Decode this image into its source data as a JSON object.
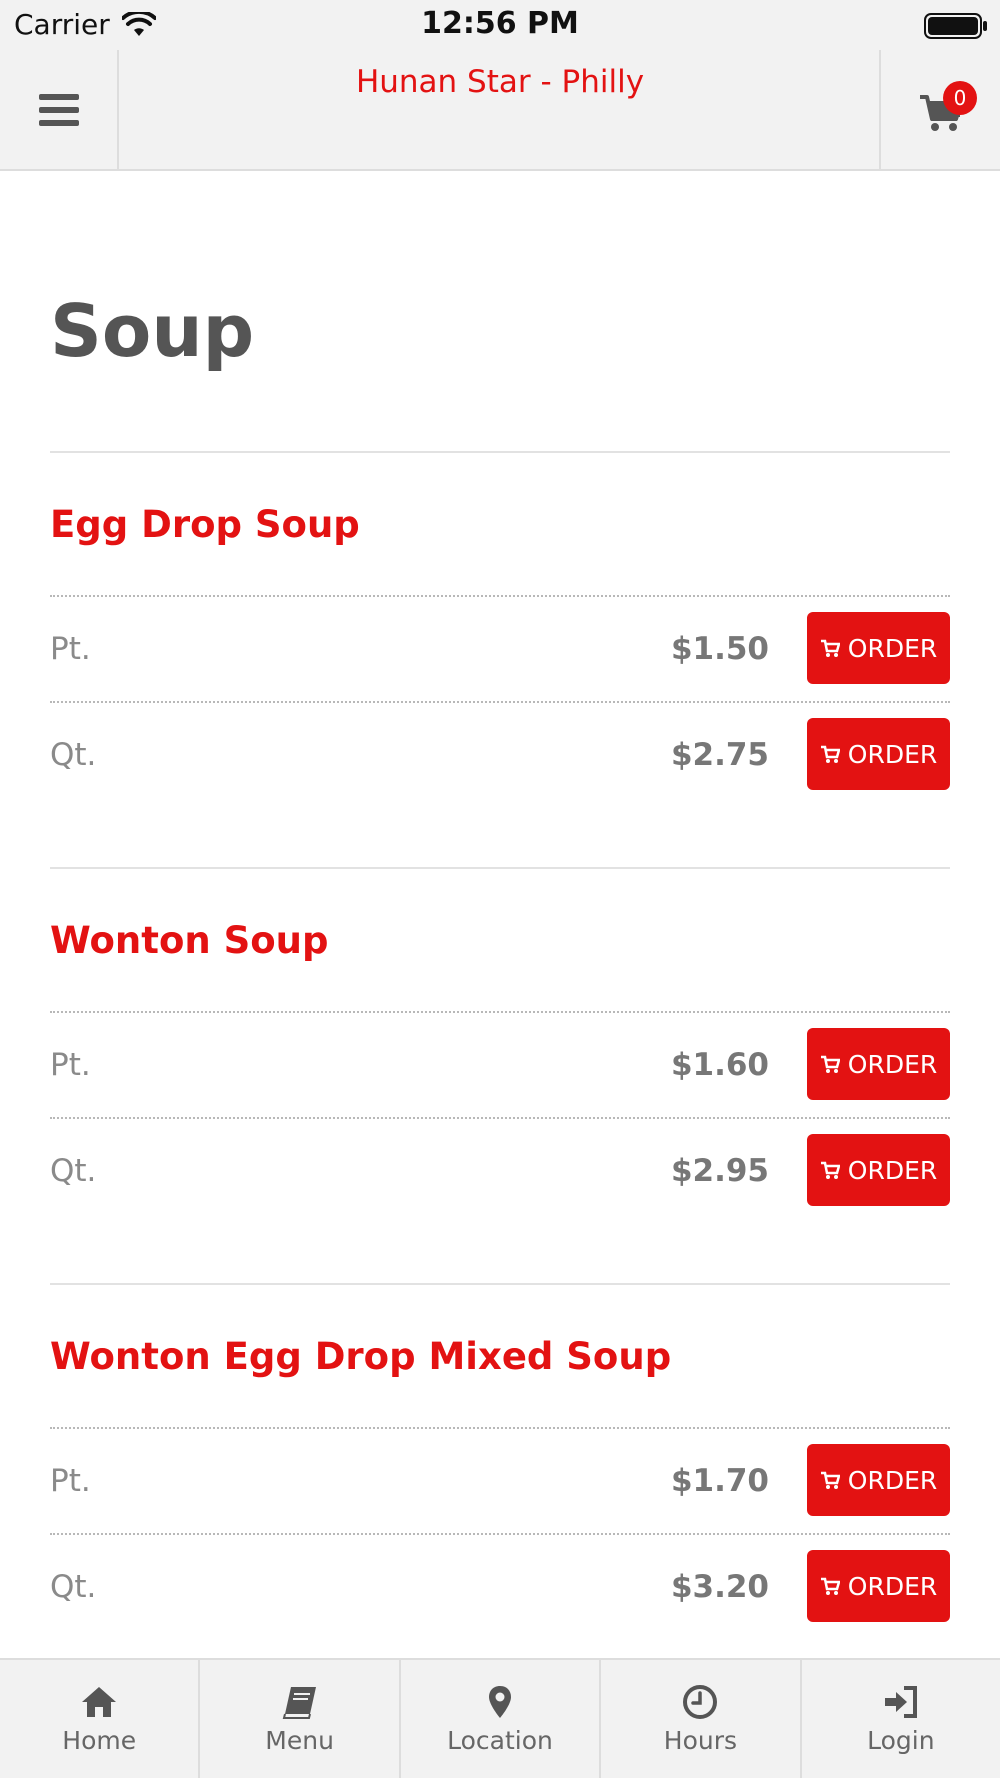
{
  "status_bar": {
    "carrier": "Carrier",
    "time": "12:56 PM"
  },
  "header": {
    "title": "Hunan Star - Philly",
    "cart_count": "0",
    "menu_icon": "hamburger-icon",
    "cart_icon": "cart-icon"
  },
  "page": {
    "title": "Soup"
  },
  "items": [
    {
      "name": "Egg Drop Soup",
      "prices": [
        {
          "size": "Pt.",
          "price": "$1.50",
          "button": "ORDER"
        },
        {
          "size": "Qt.",
          "price": "$2.75",
          "button": "ORDER"
        }
      ]
    },
    {
      "name": "Wonton Soup",
      "prices": [
        {
          "size": "Pt.",
          "price": "$1.60",
          "button": "ORDER"
        },
        {
          "size": "Qt.",
          "price": "$2.95",
          "button": "ORDER"
        }
      ]
    },
    {
      "name": "Wonton Egg Drop Mixed Soup",
      "prices": [
        {
          "size": "Pt.",
          "price": "$1.70",
          "button": "ORDER"
        },
        {
          "size": "Qt.",
          "price": "$3.20",
          "button": "ORDER"
        }
      ]
    }
  ],
  "tabs": [
    {
      "label": "Home",
      "icon": "home-icon"
    },
    {
      "label": "Menu",
      "icon": "book-icon"
    },
    {
      "label": "Location",
      "icon": "map-marker-icon"
    },
    {
      "label": "Hours",
      "icon": "clock-icon"
    },
    {
      "label": "Login",
      "icon": "sign-in-icon"
    }
  ],
  "colors": {
    "accent": "#e31212",
    "title_gray": "#555555",
    "bar_bg": "#f2f2f2"
  }
}
